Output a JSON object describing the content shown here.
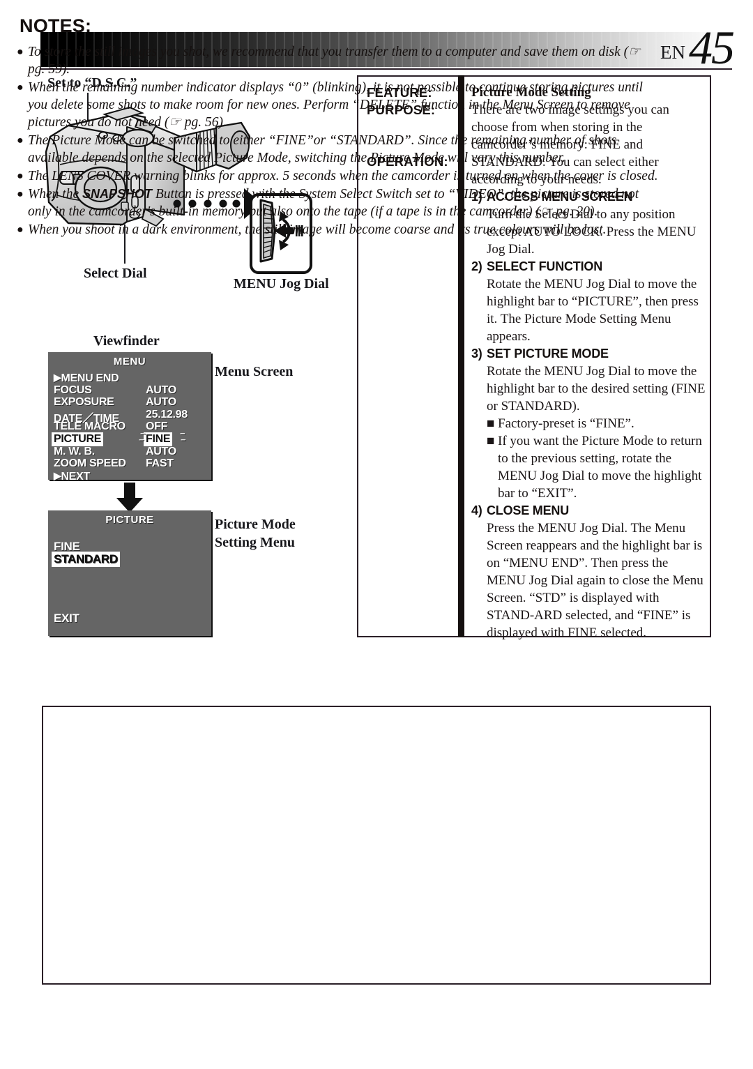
{
  "header": {
    "lang_code": "EN",
    "page_number": "45"
  },
  "illustration": {
    "label_set_dsc": "Set to “D.S.C.”",
    "label_select_dial": "Select Dial",
    "label_menu_jog_dial": "MENU Jog Dial",
    "label_viewfinder": "Viewfinder",
    "label_menu_screen": "Menu Screen",
    "label_picture_mode_setting_menu_line1": "Picture Mode",
    "label_picture_mode_setting_menu_line2": "Setting Menu"
  },
  "menu_screen": {
    "title": "MENU",
    "rows": [
      {
        "name": "MENU END",
        "value": "",
        "arrow": true,
        "name_highlighted": false,
        "value_highlighted": false
      },
      {
        "name": "FOCUS",
        "value": "AUTO",
        "arrow": false,
        "name_highlighted": false,
        "value_highlighted": false
      },
      {
        "name": "EXPOSURE",
        "value": "AUTO",
        "arrow": false,
        "name_highlighted": false,
        "value_highlighted": false
      },
      {
        "name": "DATE／TIME",
        "value": "25.12.98",
        "arrow": false,
        "name_highlighted": false,
        "value_highlighted": false
      },
      {
        "name": "TELE MACRO",
        "value": "OFF",
        "arrow": false,
        "name_highlighted": false,
        "value_highlighted": false
      },
      {
        "name": "PICTURE",
        "value": "FINE",
        "arrow": false,
        "name_highlighted": true,
        "value_highlighted": true
      },
      {
        "name": "M. W. B.",
        "value": "AUTO",
        "arrow": false,
        "name_highlighted": false,
        "value_highlighted": false
      },
      {
        "name": "ZOOM SPEED",
        "value": "FAST",
        "arrow": false,
        "name_highlighted": false,
        "value_highlighted": false
      },
      {
        "name": "NEXT",
        "value": "",
        "arrow": true,
        "name_highlighted": false,
        "value_highlighted": false
      }
    ]
  },
  "picture_menu": {
    "title": "PICTURE",
    "option_fine": "FINE",
    "option_standard": "STANDARD",
    "option_exit": "EXIT",
    "selected": "STANDARD"
  },
  "feature_table": {
    "label_feature": "FEATURE:",
    "label_purpose": "PURPOSE:",
    "label_operation": "OPERATION:",
    "feature_title": "Picture Mode Setting",
    "purpose_text": "There are two image settings you can choose from when storing in the camcorder’s memory: FINE and STANDARD. You can select either according to your needs.",
    "steps": [
      {
        "num": "1)",
        "heading": "ACCESS MENU SCREEN",
        "body": "Turn the Select Dial to any position except AUTO LOCK. Press the MENU Jog Dial.",
        "bullets": []
      },
      {
        "num": "2)",
        "heading": "SELECT FUNCTION",
        "body": "Rotate the MENU Jog Dial to move the highlight bar to “PICTURE”, then press it. The Picture Mode Setting Menu appears.",
        "bullets": []
      },
      {
        "num": "3)",
        "heading": "SET PICTURE MODE",
        "body": "Rotate the MENU Jog Dial to move the highlight bar to the desired setting (FINE or STANDARD).",
        "bullets": [
          "Factory-preset is “FINE”.",
          "If you want the Picture Mode to return to the previous setting, rotate the MENU Jog Dial to move the highlight bar to “EXIT”."
        ]
      },
      {
        "num": "4)",
        "heading": "CLOSE MENU",
        "body": "Press the MENU Jog Dial. The Menu Screen reappears and the highlight bar is on “MENU END”. Then press the MENU Jog Dial again to close the Menu Screen. “STD” is displayed with STAND-ARD selected, and “FINE” is displayed with FINE selected.",
        "bullets": []
      }
    ]
  },
  "notes": {
    "title": "NOTES:",
    "items": [
      "To store the still images you shot, we recommend that you transfer them to a computer and save them on disk (☞ pg. 59).",
      "When the remaining number indicator displays “0” (blinking), it is not possible to continue storing pictures until you delete some shots to make room for new ones. Perform “DELETE” function in the Menu Screen to remove pictures you do not need (☞ pg. 56).",
      "The Picture Mode can be switched to either “FINE”or “STANDARD”. Since the remaining number of shots available depends on the selected Picture Mode, switching the Picture Mode will vary this number.",
      "The LENS COVER warning blinks for approx. 5 seconds when the camcorder is turned on when the cover is closed.",
      "When the SNAPSHOT Button is pressed with the System Select Switch set to “VIDEO”, the picture is stored not only in the camcorder's built-in memory but also onto the tape (if a tape is in the camcorder) (☞ pg. 20).",
      "When you shoot in a dark environment, the still image will become coarse and its true colours will be lost."
    ],
    "bold_terms": [
      "SNAPSHOT"
    ]
  },
  "colors": {
    "viewfinder_bg": "#656565",
    "viewfinder_text": "#ffffff",
    "rule": "#2b2028",
    "ink": "#15100f"
  }
}
